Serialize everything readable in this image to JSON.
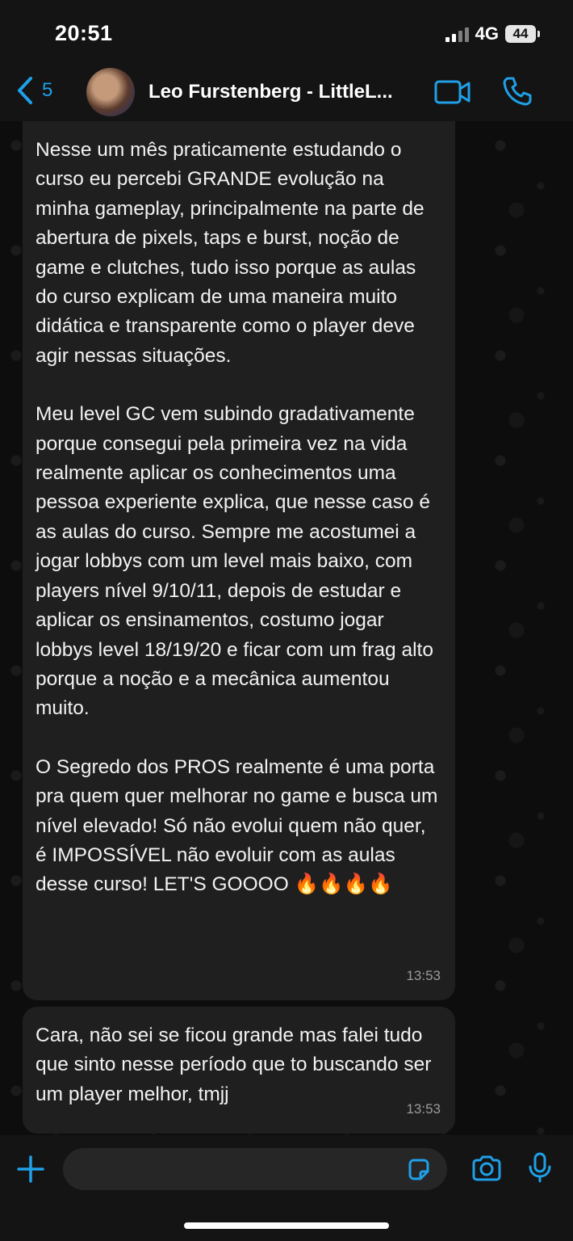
{
  "status_bar": {
    "time": "20:51",
    "network": "4G",
    "battery": "44"
  },
  "header": {
    "back_count": "5",
    "contact_name": "Leo Furstenberg - LittleL...",
    "accent_color": "#1fa0e8"
  },
  "messages": [
    {
      "paragraphs": [
        "Nesse um mês praticamente estudando o curso eu percebi GRANDE evolução na minha gameplay, principalmente na parte de abertura de pixels, taps e burst, noção de game e clutches, tudo isso porque as aulas do curso explicam de uma maneira muito didática e transparente como o player deve agir nessas situações.",
        "Meu level GC vem subindo gradativamente porque consegui pela primeira vez na vida realmente aplicar os conhecimentos uma pessoa experiente explica, que nesse caso é as aulas do curso. Sempre me acostumei a jogar lobbys com um level mais baixo, com players nível 9/10/11, depois de estudar e aplicar os ensinamentos, costumo jogar lobbys level 18/19/20 e ficar com um frag alto porque a noção e a mecânica aumentou muito.",
        "O Segredo dos PROS realmente é uma porta pra quem quer melhorar no game e busca um nível elevado! Só não evolui quem não quer, é IMPOSSÍVEL não evoluir com as aulas desse curso! LET'S GOOOO 🔥🔥🔥🔥"
      ],
      "time": "13:53"
    },
    {
      "paragraphs": [
        "Cara, não sei se ficou grande mas falei tudo que sinto nesse período que to buscando ser um player melhor, tmjj"
      ],
      "time": "13:53"
    }
  ],
  "composer": {
    "input_value": "",
    "icons": [
      "plus-icon",
      "sticker-icon",
      "camera-icon",
      "microphone-icon"
    ]
  }
}
